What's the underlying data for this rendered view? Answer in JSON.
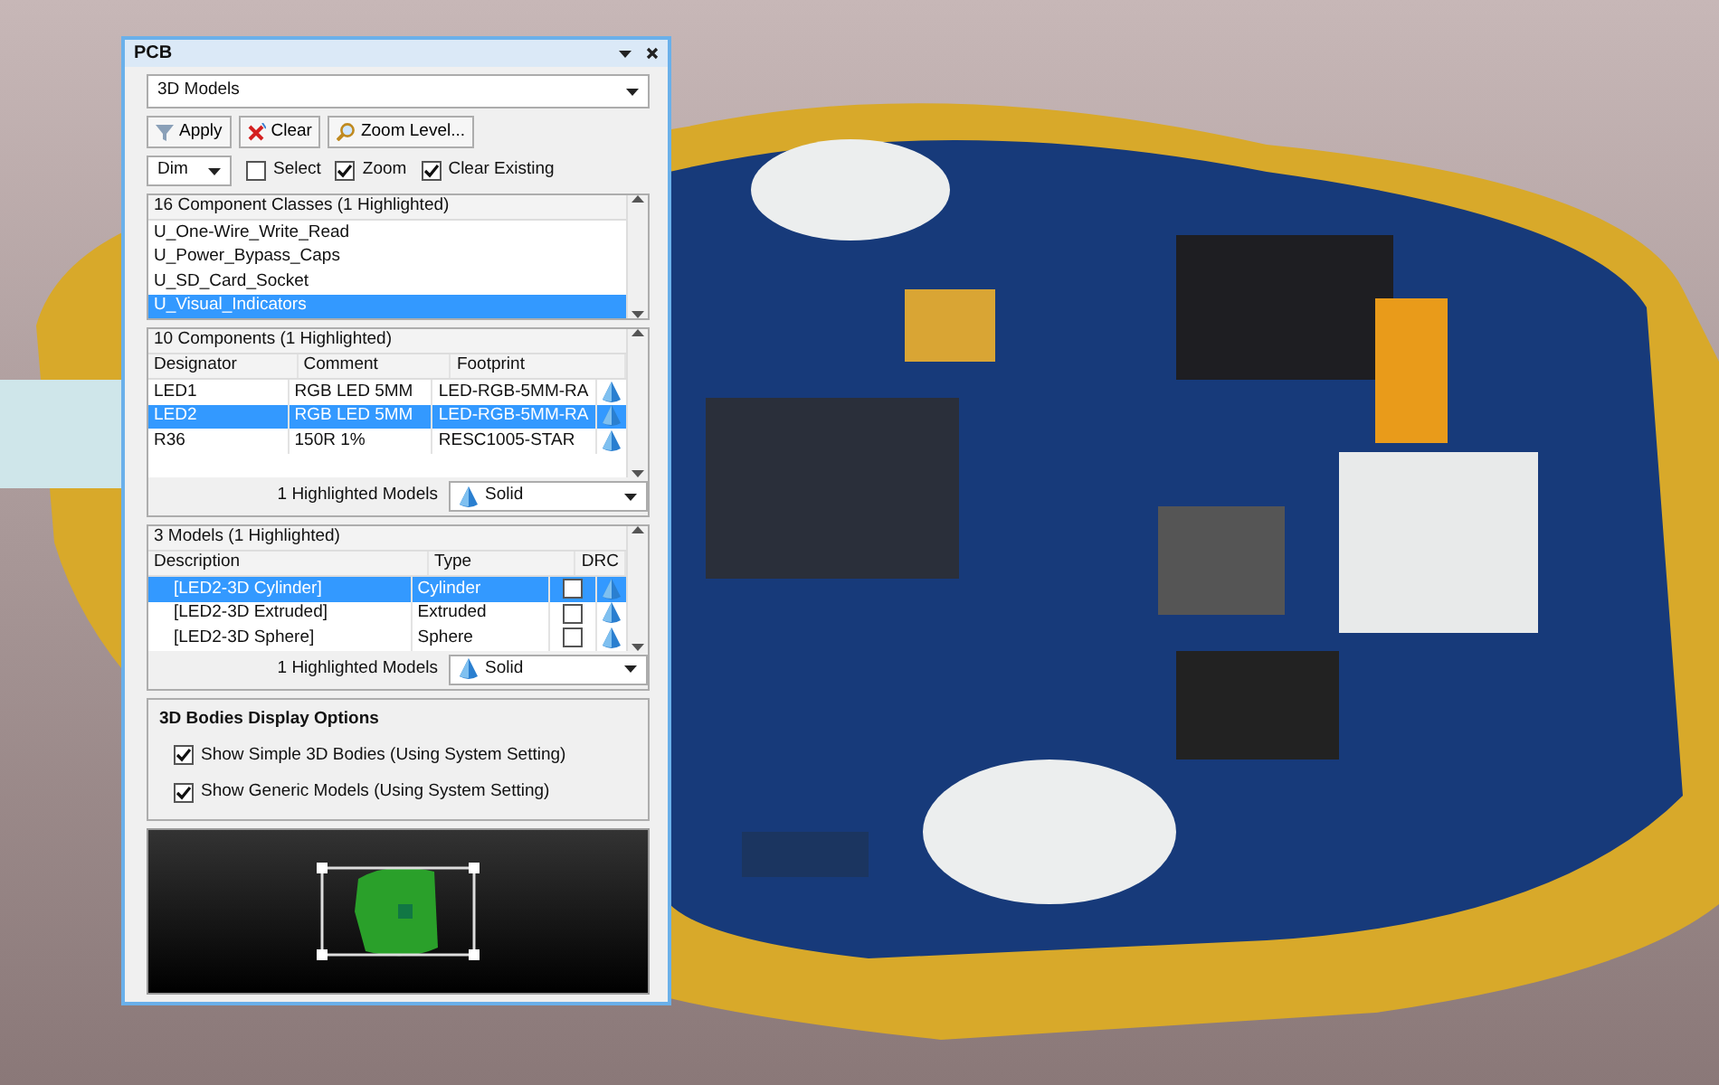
{
  "window": {
    "title": "PCB"
  },
  "mode": {
    "value": "3D Models"
  },
  "buttons": [
    {
      "label": "Apply",
      "kind": "filter"
    },
    {
      "label": "Clear",
      "kind": "clear"
    },
    {
      "label": "Zoom Level...",
      "kind": "zoom"
    }
  ],
  "mask": {
    "value": "Dim"
  },
  "checkboxes": [
    {
      "label": "Select",
      "checked": false
    },
    {
      "label": "Zoom",
      "checked": true
    },
    {
      "label": "Clear Existing",
      "checked": true
    }
  ],
  "classes": {
    "header": "16 Component Classes (1 Highlighted)",
    "rows": [
      {
        "label": "U_One-Wire_Write_Read",
        "selected": false
      },
      {
        "label": "U_Power_Bypass_Caps",
        "selected": false
      },
      {
        "label": "U_SD_Card_Socket",
        "selected": false
      },
      {
        "label": "U_Visual_Indicators",
        "selected": true
      }
    ]
  },
  "components": {
    "header": "10 Components (1 Highlighted)",
    "columns": [
      "Designator",
      "Comment",
      "Footprint"
    ],
    "rows": [
      {
        "designator": "LED1",
        "comment": "RGB LED 5MM",
        "footprint": "LED-RGB-5MM-RA",
        "selected": false
      },
      {
        "designator": "LED2",
        "comment": "RGB LED 5MM",
        "footprint": "LED-RGB-5MM-RA",
        "selected": true
      },
      {
        "designator": "R36",
        "comment": "150R 1%",
        "footprint": "RESC1005-STAR",
        "selected": false
      }
    ],
    "footer_label": "1 Highlighted Models",
    "footer_value": "Solid"
  },
  "models": {
    "header": "3 Models (1 Highlighted)",
    "columns": [
      "Description",
      "Type",
      "DRC"
    ],
    "rows": [
      {
        "description": "[LED2-3D Cylinder]",
        "type": "Cylinder",
        "drc": false,
        "selected": true
      },
      {
        "description": "[LED2-3D Extruded]",
        "type": "Extruded",
        "drc": false,
        "selected": false
      },
      {
        "description": "[LED2-3D Sphere]",
        "type": "Sphere",
        "drc": false,
        "selected": false
      }
    ],
    "footer_label": "1 Highlighted Models",
    "footer_value": "Solid"
  },
  "display_options": {
    "title": "3D Bodies Display Options",
    "options": [
      {
        "label": "Show Simple 3D Bodies (Using System Setting)",
        "checked": true
      },
      {
        "label": "Show Generic Models (Using System Setting)",
        "checked": true
      }
    ]
  }
}
